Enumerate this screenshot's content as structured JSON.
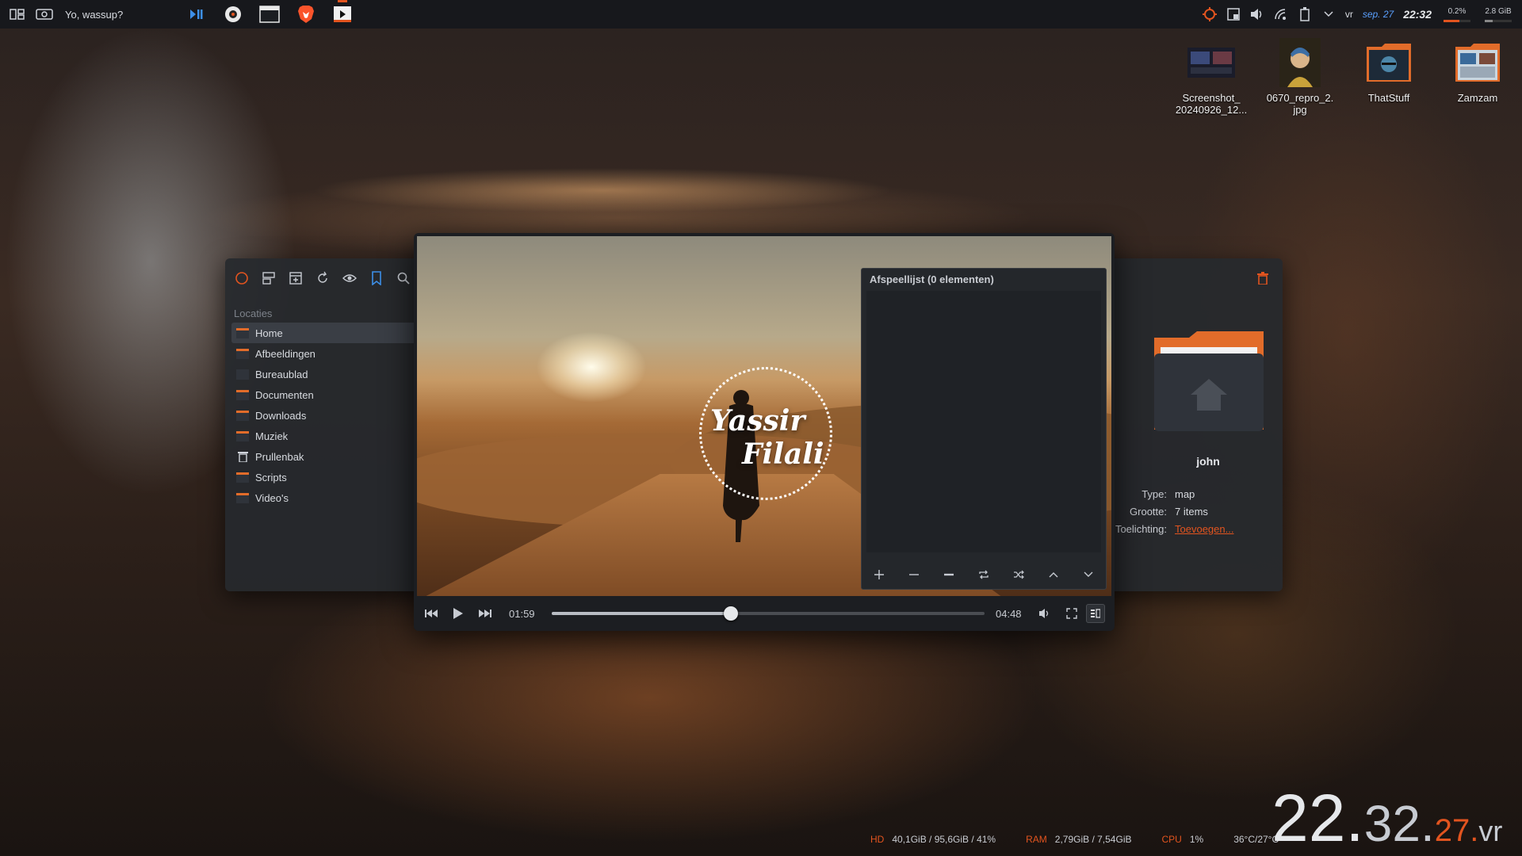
{
  "topbar": {
    "window_title": "Yo, wassup?",
    "tasks": [
      "media-player-task-icon",
      "circle-app-task-icon",
      "terminal-task-icon",
      "brave-browser-task-icon",
      "video-player-task-icon"
    ],
    "tray": {
      "lang": "vr",
      "date": "sep. 27",
      "time": "22:32",
      "cpu_pct_label": "0.2%",
      "mem_label": "2.8 GiB"
    }
  },
  "desktop_icons": [
    {
      "label_line1": "Screenshot_",
      "label_line2": "20240926_12..."
    },
    {
      "label_line1": "0670_repro_2.",
      "label_line2": "jpg"
    },
    {
      "label_line1": "ThatStuff",
      "label_line2": ""
    },
    {
      "label_line1": "Zamzam",
      "label_line2": ""
    }
  ],
  "file_manager": {
    "places_header": "Locaties",
    "places": [
      "Home",
      "Afbeeldingen",
      "Bureaublad",
      "Documenten",
      "Downloads",
      "Muziek",
      "Prullenbak",
      "Scripts",
      "Video's"
    ],
    "selected_place": "Home",
    "info": {
      "name": "john",
      "type_key": "Type:",
      "type_val": "map",
      "size_key": "Grootte:",
      "size_val": "7 items",
      "comment_key": "Toelichting:",
      "comment_val": "Toevoegen..."
    }
  },
  "media_player": {
    "video_logo_line1": "Yassir",
    "video_logo_line2": "Filali",
    "playlist_title": "Afspeellijst (0 elementen)",
    "elapsed": "01:59",
    "duration": "04:48",
    "progress_fraction": 0.414
  },
  "bottom_stats": {
    "hd_label": "HD",
    "hd_value": "40,1GiB / 95,6GiB / 41%",
    "ram_label": "RAM",
    "ram_value": "2,79GiB / 7,54GiB",
    "cpu_label": "CPU",
    "cpu_value": "1%",
    "temp_value": "36°C/27°C"
  },
  "clock": {
    "hours": "22.",
    "minutes": "32.",
    "seconds": "27.",
    "ampm": "vr"
  },
  "colors": {
    "accent": "#e2541f",
    "panel_bg": "#16181c",
    "window_bg": "#26292e",
    "date_blue": "#5aa0ff"
  }
}
